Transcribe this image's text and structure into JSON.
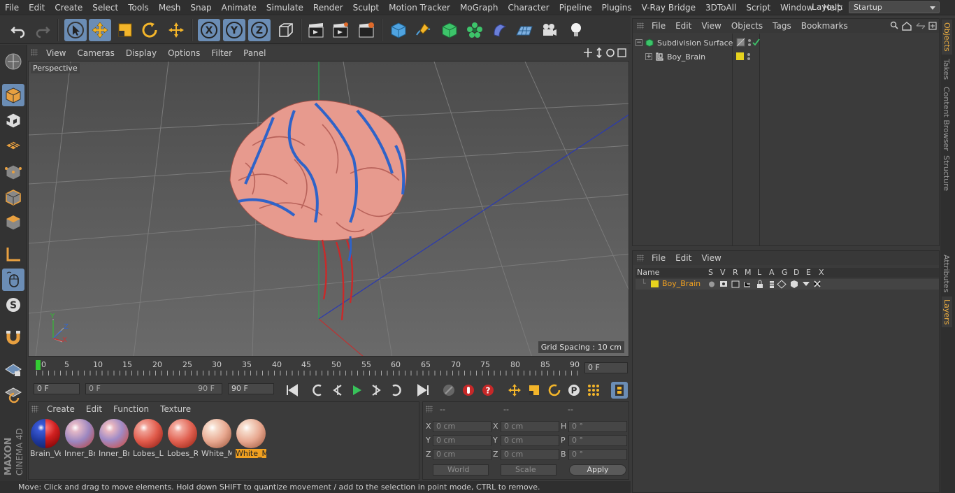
{
  "menubar": {
    "items": [
      "File",
      "Edit",
      "Create",
      "Select",
      "Tools",
      "Mesh",
      "Snap",
      "Animate",
      "Simulate",
      "Render",
      "Sculpt",
      "Motion Tracker",
      "MoGraph",
      "Character",
      "Pipeline",
      "Plugins",
      "V-Ray Bridge",
      "3DToAll",
      "Script",
      "Window",
      "Help"
    ],
    "layout_label": "Layout:",
    "layout_value": "Startup"
  },
  "viewport": {
    "menu": [
      "View",
      "Cameras",
      "Display",
      "Options",
      "Filter",
      "Panel"
    ],
    "camera_label": "Perspective",
    "grid_spacing": "Grid Spacing : 10 cm",
    "axis_labels": {
      "x": "X",
      "y": "Y",
      "z": "Z"
    }
  },
  "timeline": {
    "ticks": [
      "0",
      "5",
      "10",
      "15",
      "20",
      "25",
      "30",
      "35",
      "40",
      "45",
      "50",
      "55",
      "60",
      "65",
      "70",
      "75",
      "80",
      "85",
      "90"
    ],
    "current_frame": "0 F",
    "start_frame": "0 F",
    "range_start": "0 F",
    "range_end": "90 F",
    "end_frame": "90 F"
  },
  "materials": {
    "menu": [
      "Create",
      "Edit",
      "Function",
      "Texture"
    ],
    "items": [
      {
        "label": "Brain_Ve",
        "selected": false
      },
      {
        "label": "Inner_Br",
        "selected": false
      },
      {
        "label": "Inner_Br",
        "selected": false
      },
      {
        "label": "Lobes_L",
        "selected": false
      },
      {
        "label": "Lobes_R",
        "selected": false
      },
      {
        "label": "White_M",
        "selected": false
      },
      {
        "label": "White_M",
        "selected": true
      }
    ]
  },
  "coordinates": {
    "headers": [
      "--",
      "--",
      "--"
    ],
    "rows": [
      {
        "a": "X",
        "av": "0 cm",
        "b": "X",
        "bv": "0 cm",
        "c": "H",
        "cv": "0 °"
      },
      {
        "a": "Y",
        "av": "0 cm",
        "b": "Y",
        "bv": "0 cm",
        "c": "P",
        "cv": "0 °"
      },
      {
        "a": "Z",
        "av": "0 cm",
        "b": "Z",
        "bv": "0 cm",
        "c": "B",
        "cv": "0 °"
      }
    ],
    "world": "World",
    "scale": "Scale",
    "apply": "Apply"
  },
  "status": "Move: Click and drag to move elements. Hold down SHIFT to quantize movement / add to the selection in point mode, CTRL to remove.",
  "objects": {
    "menu": [
      "File",
      "Edit",
      "View",
      "Objects",
      "Tags",
      "Bookmarks"
    ],
    "rows": [
      {
        "name": "Subdivision Surface"
      },
      {
        "name": "Boy_Brain"
      }
    ]
  },
  "layers": {
    "menu": [
      "File",
      "Edit",
      "View"
    ],
    "columns": [
      "Name",
      "S",
      "V",
      "R",
      "M",
      "L",
      "A",
      "G",
      "D",
      "E",
      "X"
    ],
    "rows": [
      {
        "name": "Boy_Brain"
      }
    ]
  },
  "right_tabs": [
    "Objects",
    "Takes",
    "Content Browser",
    "Structure",
    "Attributes",
    "Layers"
  ],
  "brand": {
    "line1": "MAXON",
    "line2": "CINEMA 4D"
  },
  "colors": {
    "accent": "#6b8db5",
    "highlight": "#f0a020",
    "layer": "#e6d21e"
  }
}
